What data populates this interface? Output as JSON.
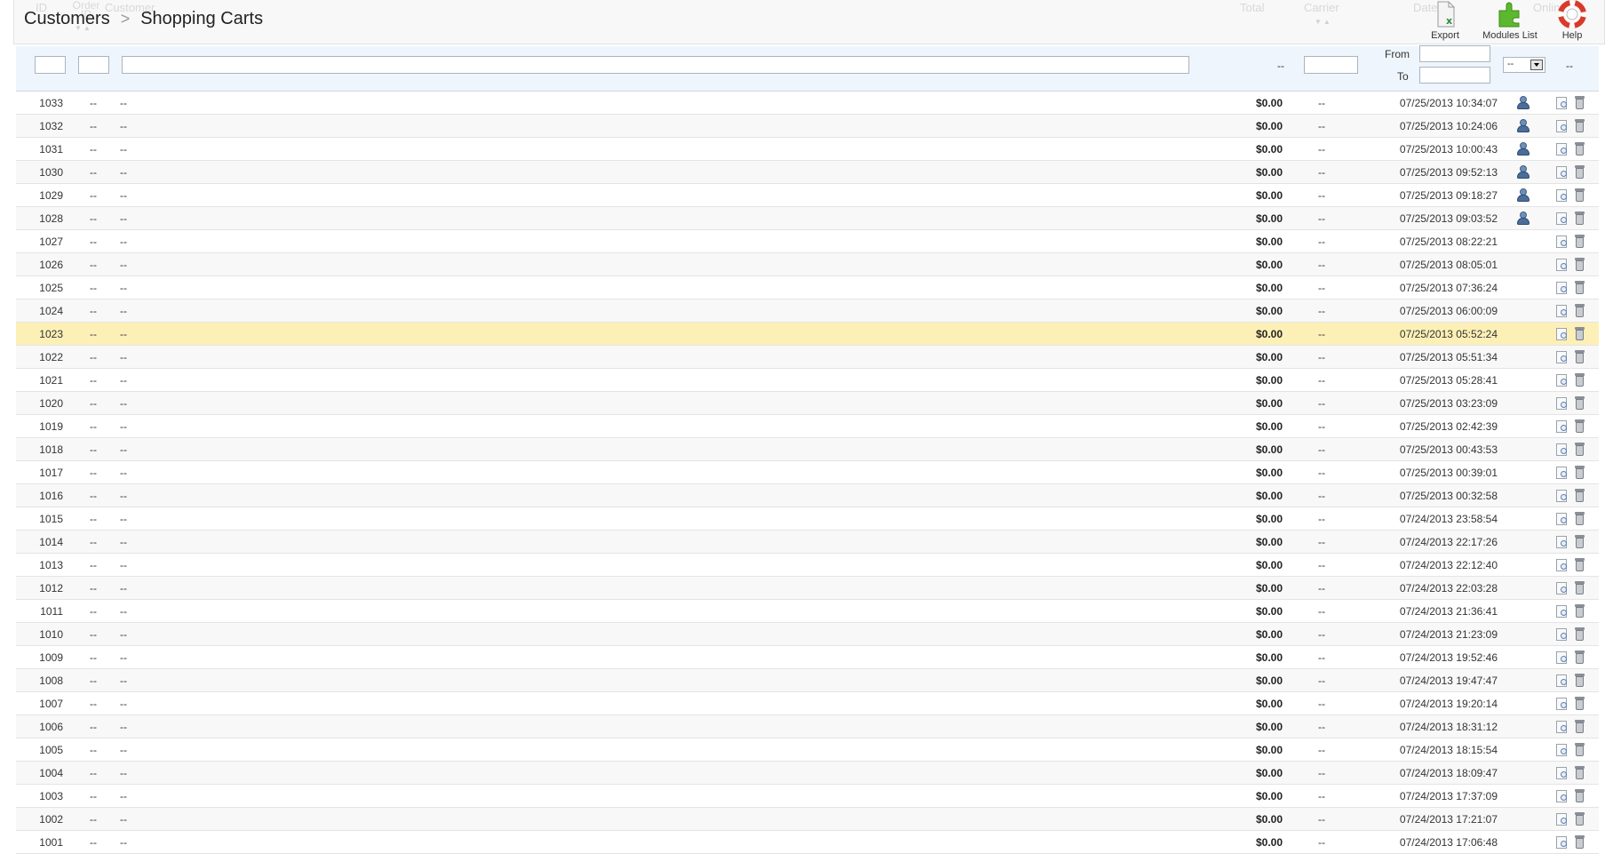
{
  "breadcrumb": {
    "parent": "Customers",
    "current": "Shopping Carts",
    "separator": ">"
  },
  "header_columns": [
    "ID",
    "Order ID",
    "Customer",
    "Total",
    "Carrier",
    "Date",
    "Online"
  ],
  "toolbar": [
    {
      "label": "Export",
      "icon": "export-icon"
    },
    {
      "label": "Modules List",
      "icon": "modules-list-icon"
    },
    {
      "label": "Help",
      "icon": "help-icon"
    }
  ],
  "filters": {
    "id_value": "",
    "order_value": "",
    "customer_value": "",
    "total_text": "--",
    "carrier_value": "",
    "date_from_label": "From",
    "date_to_label": "To",
    "date_from_value": "",
    "date_to_value": "",
    "online_select": "--",
    "actions_text": "--"
  },
  "rows": [
    {
      "id": "1033",
      "order": "--",
      "customer": "--",
      "total": "$0.00",
      "carrier": "--",
      "date": "07/25/2013 10:34:07",
      "online": true
    },
    {
      "id": "1032",
      "order": "--",
      "customer": "--",
      "total": "$0.00",
      "carrier": "--",
      "date": "07/25/2013 10:24:06",
      "online": true
    },
    {
      "id": "1031",
      "order": "--",
      "customer": "--",
      "total": "$0.00",
      "carrier": "--",
      "date": "07/25/2013 10:00:43",
      "online": true
    },
    {
      "id": "1030",
      "order": "--",
      "customer": "--",
      "total": "$0.00",
      "carrier": "--",
      "date": "07/25/2013 09:52:13",
      "online": true
    },
    {
      "id": "1029",
      "order": "--",
      "customer": "--",
      "total": "$0.00",
      "carrier": "--",
      "date": "07/25/2013 09:18:27",
      "online": true
    },
    {
      "id": "1028",
      "order": "--",
      "customer": "--",
      "total": "$0.00",
      "carrier": "--",
      "date": "07/25/2013 09:03:52",
      "online": true
    },
    {
      "id": "1027",
      "order": "--",
      "customer": "--",
      "total": "$0.00",
      "carrier": "--",
      "date": "07/25/2013 08:22:21",
      "online": false
    },
    {
      "id": "1026",
      "order": "--",
      "customer": "--",
      "total": "$0.00",
      "carrier": "--",
      "date": "07/25/2013 08:05:01",
      "online": false
    },
    {
      "id": "1025",
      "order": "--",
      "customer": "--",
      "total": "$0.00",
      "carrier": "--",
      "date": "07/25/2013 07:36:24",
      "online": false
    },
    {
      "id": "1024",
      "order": "--",
      "customer": "--",
      "total": "$0.00",
      "carrier": "--",
      "date": "07/25/2013 06:00:09",
      "online": false
    },
    {
      "id": "1023",
      "order": "--",
      "customer": "--",
      "total": "$0.00",
      "carrier": "--",
      "date": "07/25/2013 05:52:24",
      "online": false,
      "highlight": true
    },
    {
      "id": "1022",
      "order": "--",
      "customer": "--",
      "total": "$0.00",
      "carrier": "--",
      "date": "07/25/2013 05:51:34",
      "online": false
    },
    {
      "id": "1021",
      "order": "--",
      "customer": "--",
      "total": "$0.00",
      "carrier": "--",
      "date": "07/25/2013 05:28:41",
      "online": false
    },
    {
      "id": "1020",
      "order": "--",
      "customer": "--",
      "total": "$0.00",
      "carrier": "--",
      "date": "07/25/2013 03:23:09",
      "online": false
    },
    {
      "id": "1019",
      "order": "--",
      "customer": "--",
      "total": "$0.00",
      "carrier": "--",
      "date": "07/25/2013 02:42:39",
      "online": false
    },
    {
      "id": "1018",
      "order": "--",
      "customer": "--",
      "total": "$0.00",
      "carrier": "--",
      "date": "07/25/2013 00:43:53",
      "online": false
    },
    {
      "id": "1017",
      "order": "--",
      "customer": "--",
      "total": "$0.00",
      "carrier": "--",
      "date": "07/25/2013 00:39:01",
      "online": false
    },
    {
      "id": "1016",
      "order": "--",
      "customer": "--",
      "total": "$0.00",
      "carrier": "--",
      "date": "07/25/2013 00:32:58",
      "online": false
    },
    {
      "id": "1015",
      "order": "--",
      "customer": "--",
      "total": "$0.00",
      "carrier": "--",
      "date": "07/24/2013 23:58:54",
      "online": false
    },
    {
      "id": "1014",
      "order": "--",
      "customer": "--",
      "total": "$0.00",
      "carrier": "--",
      "date": "07/24/2013 22:17:26",
      "online": false
    },
    {
      "id": "1013",
      "order": "--",
      "customer": "--",
      "total": "$0.00",
      "carrier": "--",
      "date": "07/24/2013 22:12:40",
      "online": false
    },
    {
      "id": "1012",
      "order": "--",
      "customer": "--",
      "total": "$0.00",
      "carrier": "--",
      "date": "07/24/2013 22:03:28",
      "online": false
    },
    {
      "id": "1011",
      "order": "--",
      "customer": "--",
      "total": "$0.00",
      "carrier": "--",
      "date": "07/24/2013 21:36:41",
      "online": false
    },
    {
      "id": "1010",
      "order": "--",
      "customer": "--",
      "total": "$0.00",
      "carrier": "--",
      "date": "07/24/2013 21:23:09",
      "online": false
    },
    {
      "id": "1009",
      "order": "--",
      "customer": "--",
      "total": "$0.00",
      "carrier": "--",
      "date": "07/24/2013 19:52:46",
      "online": false
    },
    {
      "id": "1008",
      "order": "--",
      "customer": "--",
      "total": "$0.00",
      "carrier": "--",
      "date": "07/24/2013 19:47:47",
      "online": false
    },
    {
      "id": "1007",
      "order": "--",
      "customer": "--",
      "total": "$0.00",
      "carrier": "--",
      "date": "07/24/2013 19:20:14",
      "online": false
    },
    {
      "id": "1006",
      "order": "--",
      "customer": "--",
      "total": "$0.00",
      "carrier": "--",
      "date": "07/24/2013 18:31:12",
      "online": false
    },
    {
      "id": "1005",
      "order": "--",
      "customer": "--",
      "total": "$0.00",
      "carrier": "--",
      "date": "07/24/2013 18:15:54",
      "online": false
    },
    {
      "id": "1004",
      "order": "--",
      "customer": "--",
      "total": "$0.00",
      "carrier": "--",
      "date": "07/24/2013 18:09:47",
      "online": false
    },
    {
      "id": "1003",
      "order": "--",
      "customer": "--",
      "total": "$0.00",
      "carrier": "--",
      "date": "07/24/2013 17:37:09",
      "online": false
    },
    {
      "id": "1002",
      "order": "--",
      "customer": "--",
      "total": "$0.00",
      "carrier": "--",
      "date": "07/24/2013 17:21:07",
      "online": false
    },
    {
      "id": "1001",
      "order": "--",
      "customer": "--",
      "total": "$0.00",
      "carrier": "--",
      "date": "07/24/2013 17:06:48",
      "online": false
    }
  ],
  "colors": {
    "highlight_row": "#fdf0b6",
    "filter_bg": "#eef5fc",
    "header_bg": "#f8f8f8",
    "modules_green": "#5cb82e",
    "help_red": "#d93a2b"
  }
}
